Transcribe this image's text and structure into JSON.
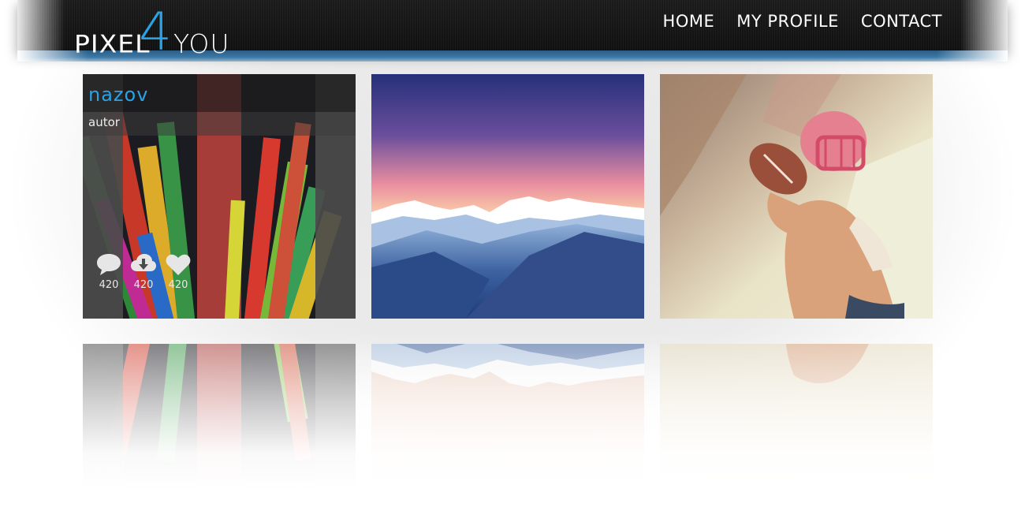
{
  "header": {
    "logo": {
      "part_a": "PIXEL",
      "digit": "4",
      "part_b": "YOU"
    },
    "nav": [
      {
        "label": "HOME"
      },
      {
        "label": "MY PROFILE"
      },
      {
        "label": "CONTACT"
      }
    ]
  },
  "gallery": {
    "tiles": [
      {
        "title": "nazov",
        "author": "autor",
        "stats": {
          "comments": "420",
          "downloads": "420",
          "likes": "420"
        },
        "icons": [
          "comment-icon",
          "download-cloud-icon",
          "heart-icon"
        ]
      },
      {},
      {}
    ]
  },
  "colors": {
    "accent": "#2aa3e6",
    "header_bg": "#111111",
    "stripe": "#2b5d86"
  }
}
